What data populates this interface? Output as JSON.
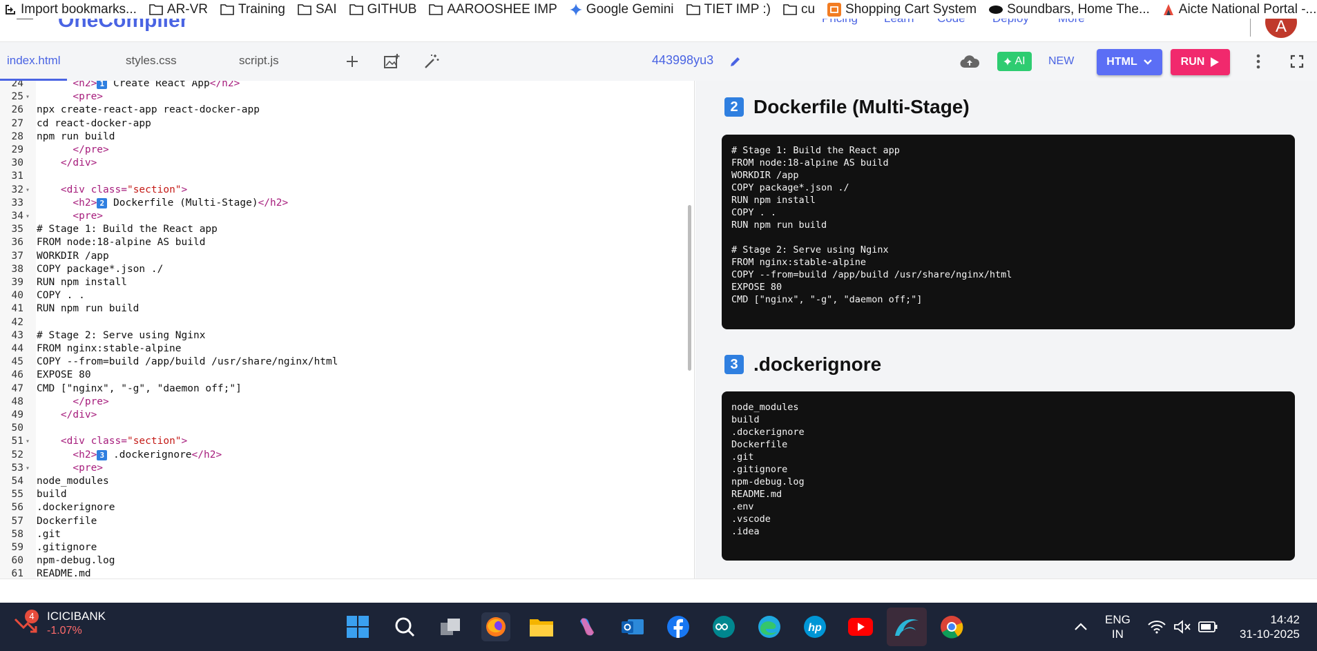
{
  "bookmarks": [
    "Import bookmarks...",
    "AR-VR",
    "Training",
    "SAI",
    "GITHUB",
    "AAROOSHEE IMP",
    "Google Gemini",
    "TIET IMP :)",
    "cu",
    "Shopping Cart System",
    "Soundbars, Home The...",
    "Aicte National Portal -..."
  ],
  "app_header": {
    "logo": "OneCompiler",
    "nav": [
      "Pricing",
      "Learn",
      "Code",
      "Deploy",
      "More"
    ],
    "avatar_letter": "A"
  },
  "tabs": [
    "index.html",
    "styles.css",
    "script.js"
  ],
  "file_id": "443998yu3",
  "toolbar": {
    "ai": "AI",
    "new": "NEW",
    "html": "HTML",
    "run": "RUN"
  },
  "code_lines": [
    {
      "n": "24",
      "fold": "",
      "kind": "h2",
      "badge": "1",
      "text": " Create React App"
    },
    {
      "n": "25",
      "fold": "▾",
      "kind": "tag",
      "indent": "      ",
      "text": "<pre>"
    },
    {
      "n": "26",
      "fold": "",
      "kind": "plain",
      "text": "npx create-react-app react-docker-app"
    },
    {
      "n": "27",
      "fold": "",
      "kind": "plain",
      "text": "cd react-docker-app"
    },
    {
      "n": "28",
      "fold": "",
      "kind": "plain",
      "text": "npm run build"
    },
    {
      "n": "29",
      "fold": "",
      "kind": "tag",
      "indent": "      ",
      "text": "</pre>"
    },
    {
      "n": "30",
      "fold": "",
      "kind": "tag",
      "indent": "    ",
      "text": "</div>"
    },
    {
      "n": "31",
      "fold": "",
      "kind": "plain",
      "text": ""
    },
    {
      "n": "32",
      "fold": "▾",
      "kind": "div",
      "indent": "    ",
      "text": "section"
    },
    {
      "n": "33",
      "fold": "",
      "kind": "h2",
      "badge": "2",
      "text": " Dockerfile (Multi-Stage)"
    },
    {
      "n": "34",
      "fold": "▾",
      "kind": "tag",
      "indent": "      ",
      "text": "<pre>"
    },
    {
      "n": "35",
      "fold": "",
      "kind": "plain",
      "text": "# Stage 1: Build the React app"
    },
    {
      "n": "36",
      "fold": "",
      "kind": "plain",
      "text": "FROM node:18-alpine AS build"
    },
    {
      "n": "37",
      "fold": "",
      "kind": "plain",
      "text": "WORKDIR /app"
    },
    {
      "n": "38",
      "fold": "",
      "kind": "plain",
      "text": "COPY package*.json ./"
    },
    {
      "n": "39",
      "fold": "",
      "kind": "plain",
      "text": "RUN npm install"
    },
    {
      "n": "40",
      "fold": "",
      "kind": "plain",
      "text": "COPY . ."
    },
    {
      "n": "41",
      "fold": "",
      "kind": "plain",
      "text": "RUN npm run build"
    },
    {
      "n": "42",
      "fold": "",
      "kind": "plain",
      "text": ""
    },
    {
      "n": "43",
      "fold": "",
      "kind": "plain",
      "text": "# Stage 2: Serve using Nginx"
    },
    {
      "n": "44",
      "fold": "",
      "kind": "plain",
      "text": "FROM nginx:stable-alpine"
    },
    {
      "n": "45",
      "fold": "",
      "kind": "plain",
      "text": "COPY --from=build /app/build /usr/share/nginx/html"
    },
    {
      "n": "46",
      "fold": "",
      "kind": "plain",
      "text": "EXPOSE 80"
    },
    {
      "n": "47",
      "fold": "",
      "kind": "plain",
      "text": "CMD [\"nginx\", \"-g\", \"daemon off;\"]"
    },
    {
      "n": "48",
      "fold": "",
      "kind": "tag",
      "indent": "      ",
      "text": "</pre>"
    },
    {
      "n": "49",
      "fold": "",
      "kind": "tag",
      "indent": "    ",
      "text": "</div>"
    },
    {
      "n": "50",
      "fold": "",
      "kind": "plain",
      "text": ""
    },
    {
      "n": "51",
      "fold": "▾",
      "kind": "div",
      "indent": "    ",
      "text": "section"
    },
    {
      "n": "52",
      "fold": "",
      "kind": "h2",
      "badge": "3",
      "text": " .dockerignore"
    },
    {
      "n": "53",
      "fold": "▾",
      "kind": "tag",
      "indent": "      ",
      "text": "<pre>"
    },
    {
      "n": "54",
      "fold": "",
      "kind": "plain",
      "text": "node_modules"
    },
    {
      "n": "55",
      "fold": "",
      "kind": "plain",
      "text": "build"
    },
    {
      "n": "56",
      "fold": "",
      "kind": "plain",
      "text": ".dockerignore"
    },
    {
      "n": "57",
      "fold": "",
      "kind": "plain",
      "text": "Dockerfile"
    },
    {
      "n": "58",
      "fold": "",
      "kind": "plain",
      "text": ".git"
    },
    {
      "n": "59",
      "fold": "",
      "kind": "plain",
      "text": ".gitignore"
    },
    {
      "n": "60",
      "fold": "",
      "kind": "plain",
      "text": "npm-debug.log"
    },
    {
      "n": "61",
      "fold": "",
      "kind": "plain",
      "text": "README.md"
    }
  ],
  "preview": {
    "sections": [
      {
        "badge": "2",
        "title": "Dockerfile (Multi-Stage)",
        "code": "# Stage 1: Build the React app\nFROM node:18-alpine AS build\nWORKDIR /app\nCOPY package*.json ./\nRUN npm install\nCOPY . .\nRUN npm run build\n\n# Stage 2: Serve using Nginx\nFROM nginx:stable-alpine\nCOPY --from=build /app/build /usr/share/nginx/html\nEXPOSE 80\nCMD [\"nginx\", \"-g\", \"daemon off;\"]\n"
      },
      {
        "badge": "3",
        "title": ".dockerignore",
        "code": "node_modules\nbuild\n.dockerignore\nDockerfile\n.git\n.gitignore\nnpm-debug.log\nREADME.md\n.env\n.vscode\n.idea\n"
      }
    ]
  },
  "taskbar": {
    "stock_name": "ICICIBANK",
    "stock_change": "-1.07%",
    "notification_count": "4",
    "lang_1": "ENG",
    "lang_2": "IN",
    "time": "14:42",
    "date": "31-10-2025"
  },
  "colors": {
    "accent": "#4a64e3",
    "ai_green": "#2ecc71",
    "html_btn": "#5b6ef5",
    "run_btn": "#f1296d",
    "tag_color": "#a61c7c",
    "string_color": "#c41a16",
    "taskbar": "#1c2437"
  }
}
